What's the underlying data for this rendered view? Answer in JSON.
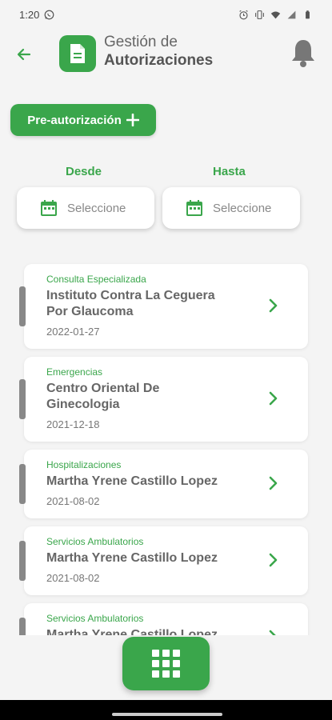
{
  "status_bar": {
    "time": "1:20",
    "left_icons": [
      "whatsapp-icon"
    ],
    "right_icons": [
      "alarm-icon",
      "vibrate-icon",
      "wifi-icon",
      "signal-icon",
      "battery-icon"
    ]
  },
  "header": {
    "title_line1": "Gestión de",
    "title_line2": "Autorizaciones",
    "back_icon": "arrow-left-icon",
    "logo_icon": "document-icon",
    "bell_icon": "bell-icon"
  },
  "preauth": {
    "label": "Pre-autorización",
    "icon": "plus-icon"
  },
  "filters": {
    "from_label": "Desde",
    "to_label": "Hasta",
    "from_placeholder": "Seleccione",
    "to_placeholder": "Seleccione"
  },
  "items": [
    {
      "category": "Consulta Especializada",
      "name_line1": "Instituto Contra La Ceguera",
      "name_line2": "Por Glaucoma",
      "date": "2022-01-27"
    },
    {
      "category": "Emergencias",
      "name_line1": "Centro Oriental De",
      "name_line2": "Ginecologia",
      "date": "2021-12-18"
    },
    {
      "category": "Hospitalizaciones",
      "name_line1": "Martha Yrene Castillo Lopez",
      "name_line2": "",
      "date": "2021-08-02"
    },
    {
      "category": "Servicios Ambulatorios",
      "name_line1": "Martha Yrene Castillo Lopez",
      "name_line2": "",
      "date": "2021-08-02"
    },
    {
      "category": "Servicios Ambulatorios",
      "name_line1": "Martha Yrene Castillo Lopez",
      "name_line2": "",
      "date": ""
    }
  ],
  "fab": {
    "icon": "grid-menu-icon"
  },
  "colors": {
    "accent": "#3aa64b",
    "background": "#f4f4f4",
    "card": "#ffffff"
  }
}
